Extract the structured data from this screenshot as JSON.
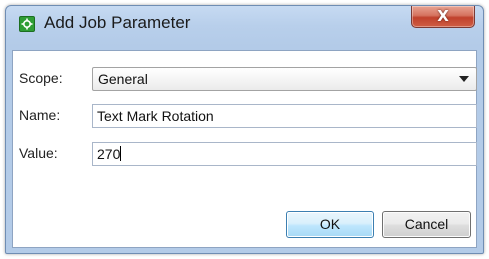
{
  "window": {
    "title": "Add Job Parameter",
    "app_icon": "green-gear-icon",
    "close_icon": "close-icon",
    "close_glyph": "X"
  },
  "form": {
    "scope": {
      "label": "Scope:",
      "selected": "General"
    },
    "name": {
      "label": "Name:",
      "value": "Text Mark Rotation"
    },
    "value": {
      "label": "Value:",
      "value": "270"
    }
  },
  "buttons": {
    "ok": "OK",
    "cancel": "Cancel"
  },
  "colors": {
    "title_bar": "#b8cfeb",
    "close_button": "#c9503a",
    "ok_button_border": "#3c7fb1",
    "app_icon": "#2f9d35"
  }
}
